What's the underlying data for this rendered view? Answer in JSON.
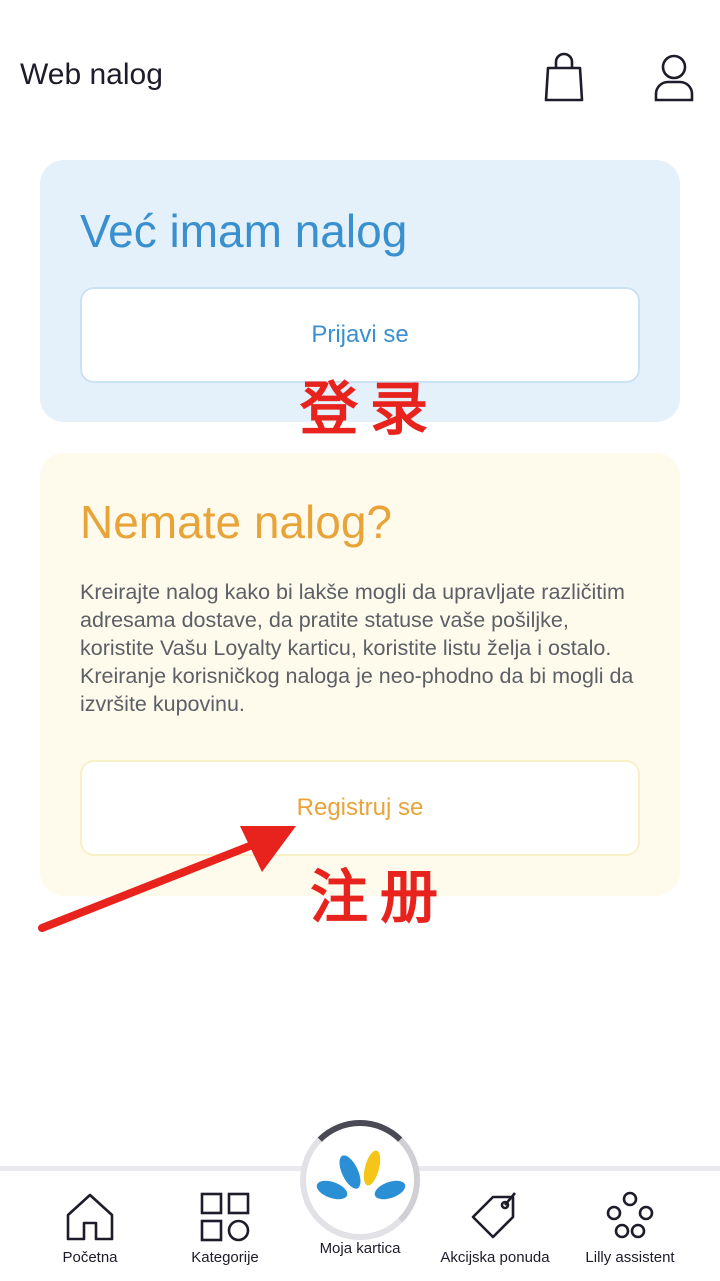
{
  "header": {
    "title": "Web nalog",
    "cart_icon": "shopping-bag-icon",
    "user_icon": "user-icon"
  },
  "login_card": {
    "title": "Već imam nalog",
    "button_label": "Prijavi se",
    "annotation": "登录",
    "color": "#3a90cf",
    "bg": "#e4f1fb"
  },
  "register_card": {
    "title": "Nemate nalog?",
    "description": "Kreirajte nalog kako bi lakše mogli da upravljate različitim adresama dostave, da pratite statuse vaše pošiljke, koristite Vašu Loyalty karticu, koristite listu želja i ostalo. Kreiranje korisničkog naloga je neo-phodno da bi mogli da izvršite kupovinu.",
    "button_label": "Registruj se",
    "annotation": "注册",
    "color": "#e8a339",
    "bg": "#fefaec"
  },
  "bottom_nav": {
    "items": [
      {
        "label": "Početna",
        "icon": "home-icon"
      },
      {
        "label": "Kategorije",
        "icon": "categories-icon"
      },
      {
        "label": "Moja kartica",
        "icon": "loyalty-card-icon"
      },
      {
        "label": "Akcijska ponuda",
        "icon": "tag-icon"
      },
      {
        "label": "Lilly assistent",
        "icon": "assistant-icon"
      }
    ]
  },
  "colors": {
    "annotation_red": "#e8221c",
    "text_dark": "#1c1c2a"
  }
}
